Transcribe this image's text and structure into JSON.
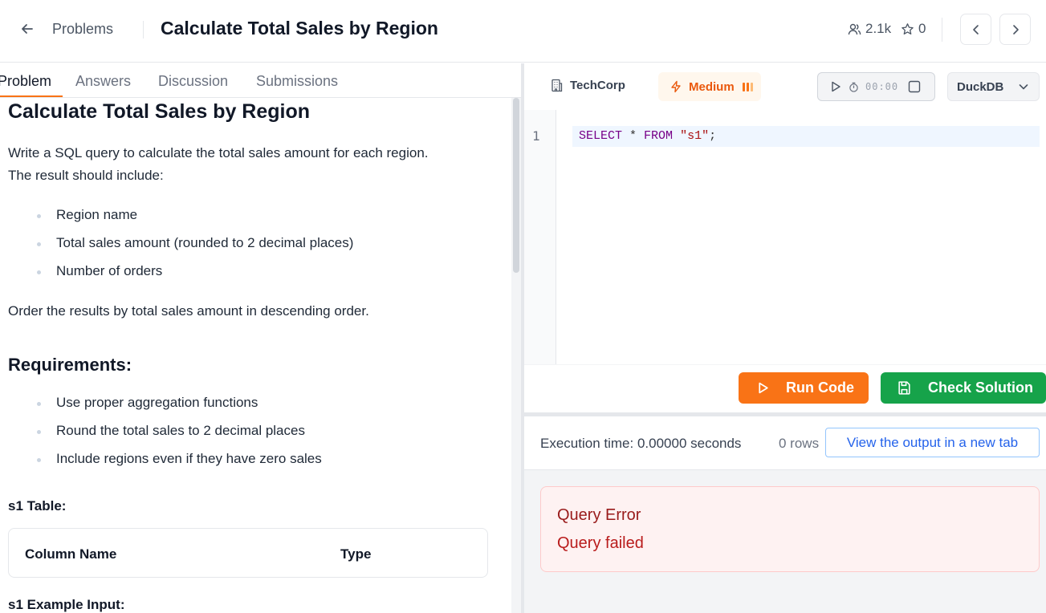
{
  "header": {
    "breadcrumb": "Problems",
    "title": "Calculate Total Sales by Region",
    "participants": "2.1k",
    "stars": "0"
  },
  "tabs": [
    {
      "label": "Problem",
      "active": true
    },
    {
      "label": "Answers",
      "active": false
    },
    {
      "label": "Discussion",
      "active": false
    },
    {
      "label": "Submissions",
      "active": false
    }
  ],
  "problem": {
    "heading": "Calculate Total Sales by Region",
    "intro_line1": "Write a SQL query to calculate the total sales amount for each region.",
    "intro_line2": "The result should include:",
    "include_items": [
      "Region name",
      "Total sales amount (rounded to 2 decimal places)",
      "Number of orders"
    ],
    "order_note": "Order the results by total sales amount in descending order.",
    "requirements_heading": "Requirements:",
    "requirements": [
      "Use proper aggregation functions",
      "Round the total sales to 2 decimal places",
      "Include regions even if they have zero sales"
    ],
    "table_heading": "s1 Table:",
    "table_columns": [
      "Column Name",
      "Type"
    ],
    "example_heading": "s1 Example Input:"
  },
  "toolbar": {
    "company": "TechCorp",
    "difficulty": "Medium",
    "timer": "00:00",
    "database": "DuckDB"
  },
  "editor": {
    "line_number": "1",
    "code_keyword1": "SELECT",
    "code_op": " * ",
    "code_keyword2": "FROM",
    "code_space": " ",
    "code_string": "\"s1\"",
    "code_end": ";"
  },
  "actions": {
    "run_label": "Run Code",
    "check_label": "Check Solution"
  },
  "results": {
    "exec_time": "Execution time: 0.00000 seconds",
    "row_count": "0 rows",
    "new_tab_label": "View the output in a new tab",
    "error_title": "Query Error",
    "error_message": "Query failed"
  },
  "colors": {
    "accent": "#f97316",
    "success": "#16a34a",
    "error": "#991b1b",
    "link": "#2563eb"
  }
}
